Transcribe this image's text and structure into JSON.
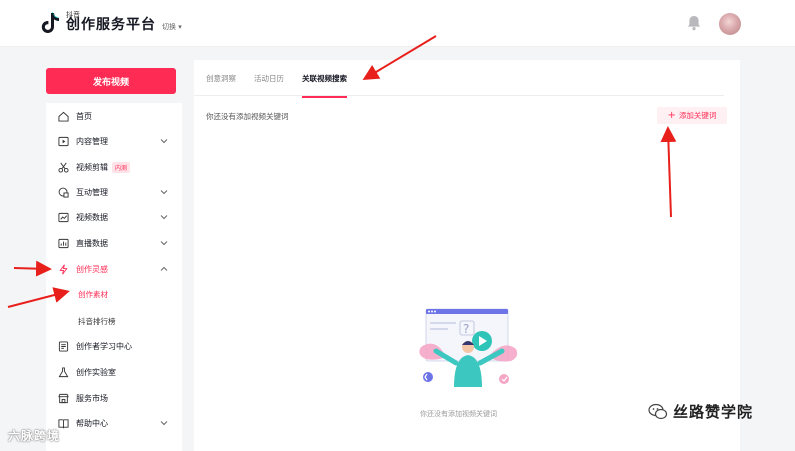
{
  "header": {
    "logo_small": "抖音",
    "title": "创作服务平台",
    "switch_label": "切换",
    "icons": {
      "logo": "douyin-logo-icon",
      "bell": "bell-icon",
      "avatar": "user-avatar"
    }
  },
  "sidebar": {
    "publish_label": "发布视频",
    "items": [
      {
        "label": "首页",
        "icon": "home-icon"
      },
      {
        "label": "内容管理",
        "icon": "content-icon"
      },
      {
        "label": "视频剪辑",
        "icon": "scissors-icon",
        "badge": "内测"
      },
      {
        "label": "互动管理",
        "icon": "interaction-icon"
      },
      {
        "label": "视频数据",
        "icon": "chart-icon"
      },
      {
        "label": "直播数据",
        "icon": "live-icon"
      },
      {
        "label": "创作灵感",
        "icon": "lightning-icon"
      },
      {
        "label": "创作者学习中心",
        "icon": "book-icon"
      },
      {
        "label": "创作实验室",
        "icon": "flask-icon"
      },
      {
        "label": "服务市场",
        "icon": "store-icon"
      },
      {
        "label": "帮助中心",
        "icon": "help-book-icon"
      }
    ],
    "sub_items": [
      "创作素材",
      "抖音排行榜"
    ]
  },
  "main": {
    "tabs": [
      "创意洞察",
      "活动日历",
      "关联视频搜索"
    ],
    "hint": "你还没有添加视频关键词",
    "add_button": "添加关键词",
    "empty_caption": "你还没有添加视频关键词"
  },
  "watermarks": {
    "left": "六脉跨境",
    "right": "丝路赞学院"
  },
  "colors": {
    "accent": "#fe2c55",
    "annotation_arrow": "#e8201c"
  }
}
